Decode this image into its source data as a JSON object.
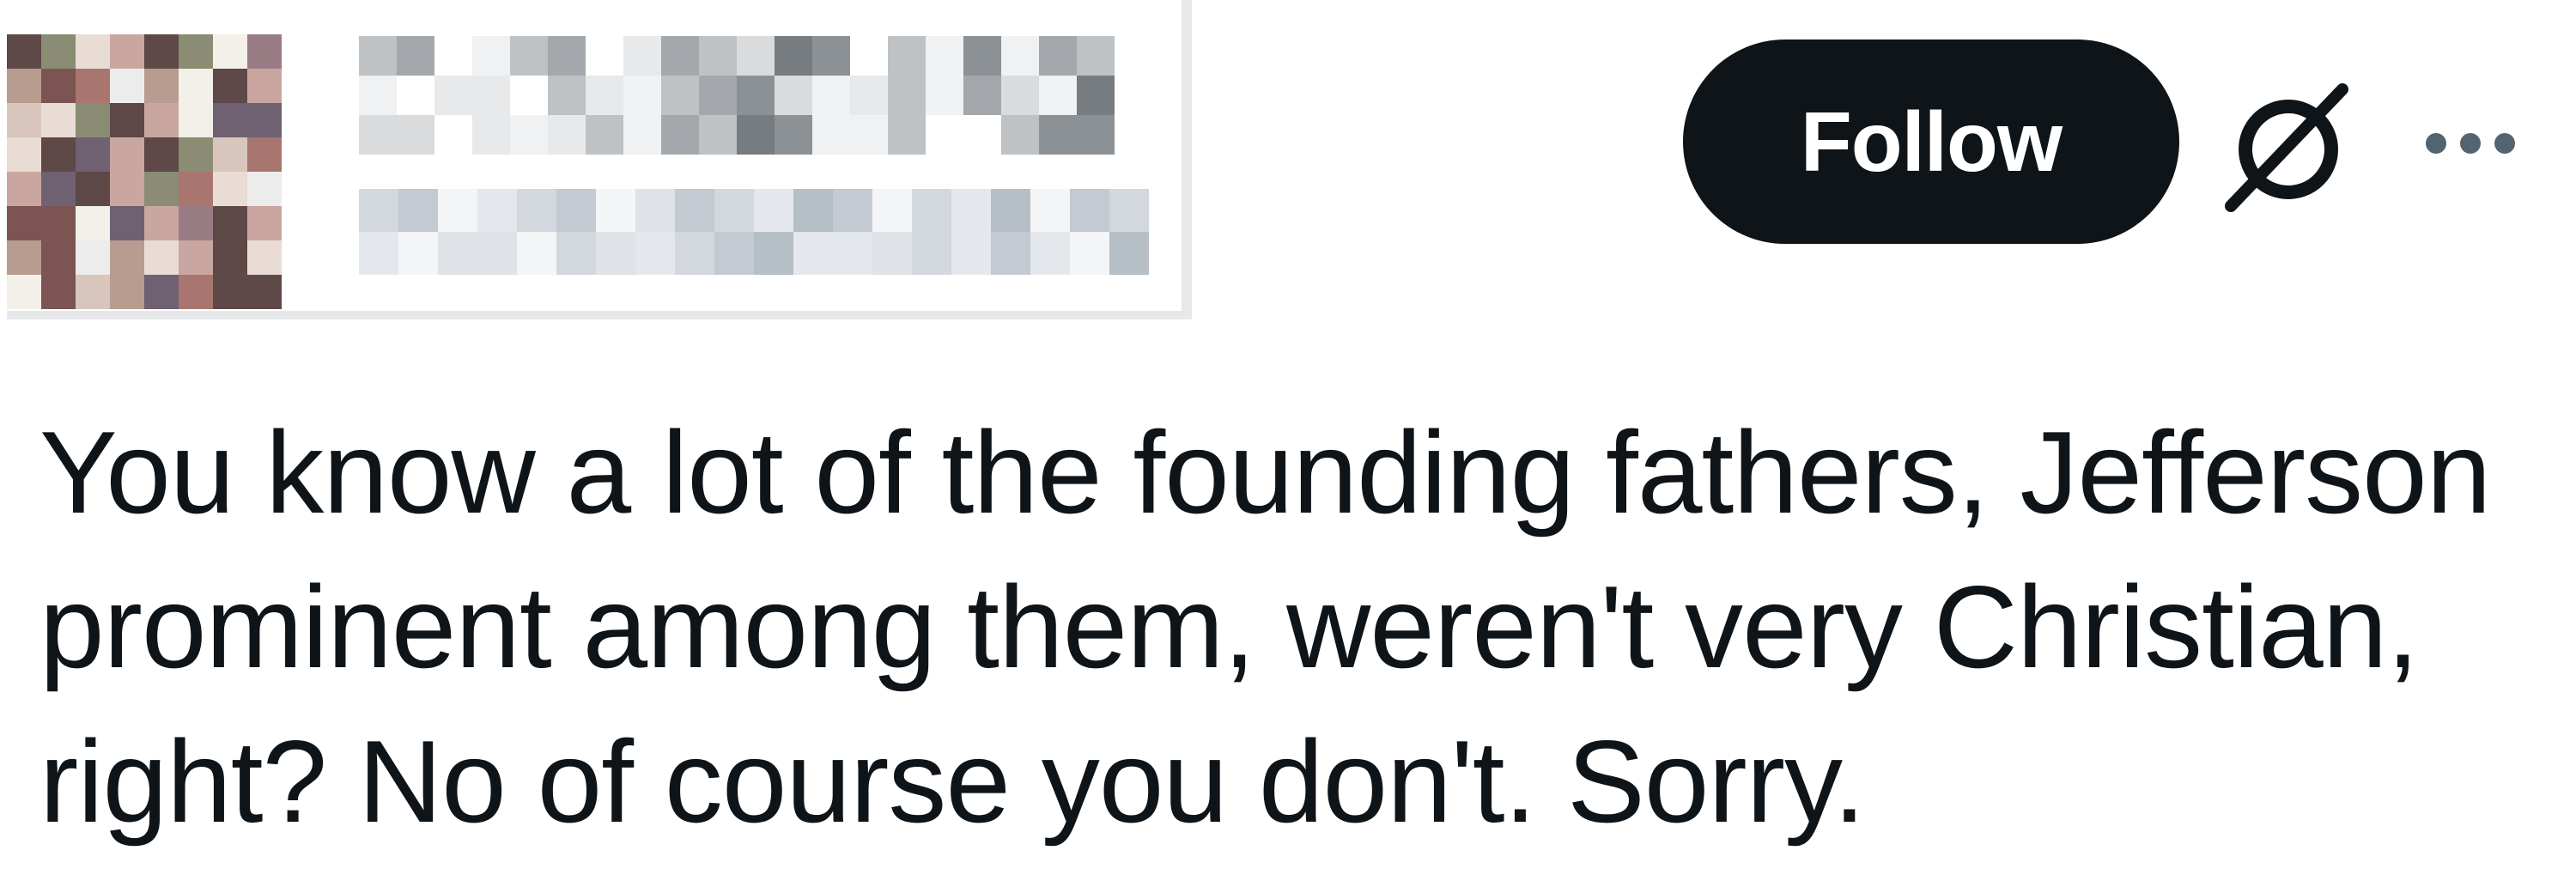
{
  "header": {
    "follow_label": "Follow",
    "grok_icon": "grok-slash-icon",
    "more_icon": "more-horizontal-icon"
  },
  "tweet": {
    "lines": [
      "You know a lot of the founding fathers, Jefferson",
      "prominent among them, weren't very Christian,",
      "right? No of course you don't. Sorry."
    ]
  },
  "colors": {
    "text": "#0f1419",
    "button_bg": "#0f1419",
    "button_text": "#ffffff",
    "background": "#ffffff",
    "divider": "#e6e8ea"
  }
}
